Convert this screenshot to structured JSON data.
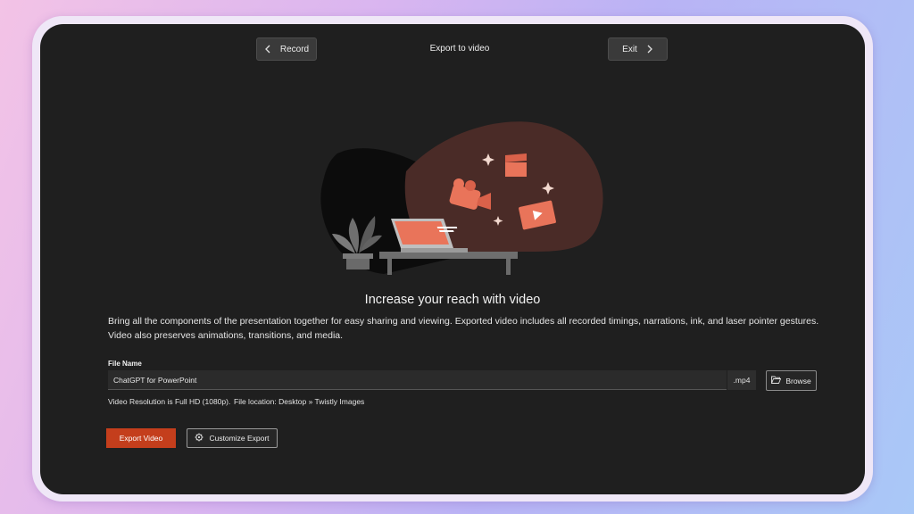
{
  "header": {
    "back_label": "Record",
    "title": "Export to video",
    "exit_label": "Exit"
  },
  "main": {
    "headline": "Increase your reach with video",
    "description": "Bring all the components of the presentation together for easy sharing and viewing. Exported video includes all recorded timings, narrations, ink, and laser pointer gestures. Video also preserves animations, transitions, and media."
  },
  "form": {
    "file_name_label": "File Name",
    "file_name_value": "ChatGPT for PowerPoint",
    "extension": ".mp4",
    "browse_label": "Browse",
    "resolution_info": "Video Resolution is Full HD (1080p).",
    "location_info": "File location: Desktop » Twistly Images"
  },
  "actions": {
    "export_label": "Export Video",
    "customize_label": "Customize Export"
  },
  "colors": {
    "accent": "#c43e1c",
    "window_bg": "#1f1f1f",
    "illustration_blob": "#4a2b27"
  },
  "icons": {
    "back": "chevron-left-icon",
    "exit": "chevron-right-icon",
    "browse": "folder-open-icon",
    "customize": "gear-icon"
  }
}
